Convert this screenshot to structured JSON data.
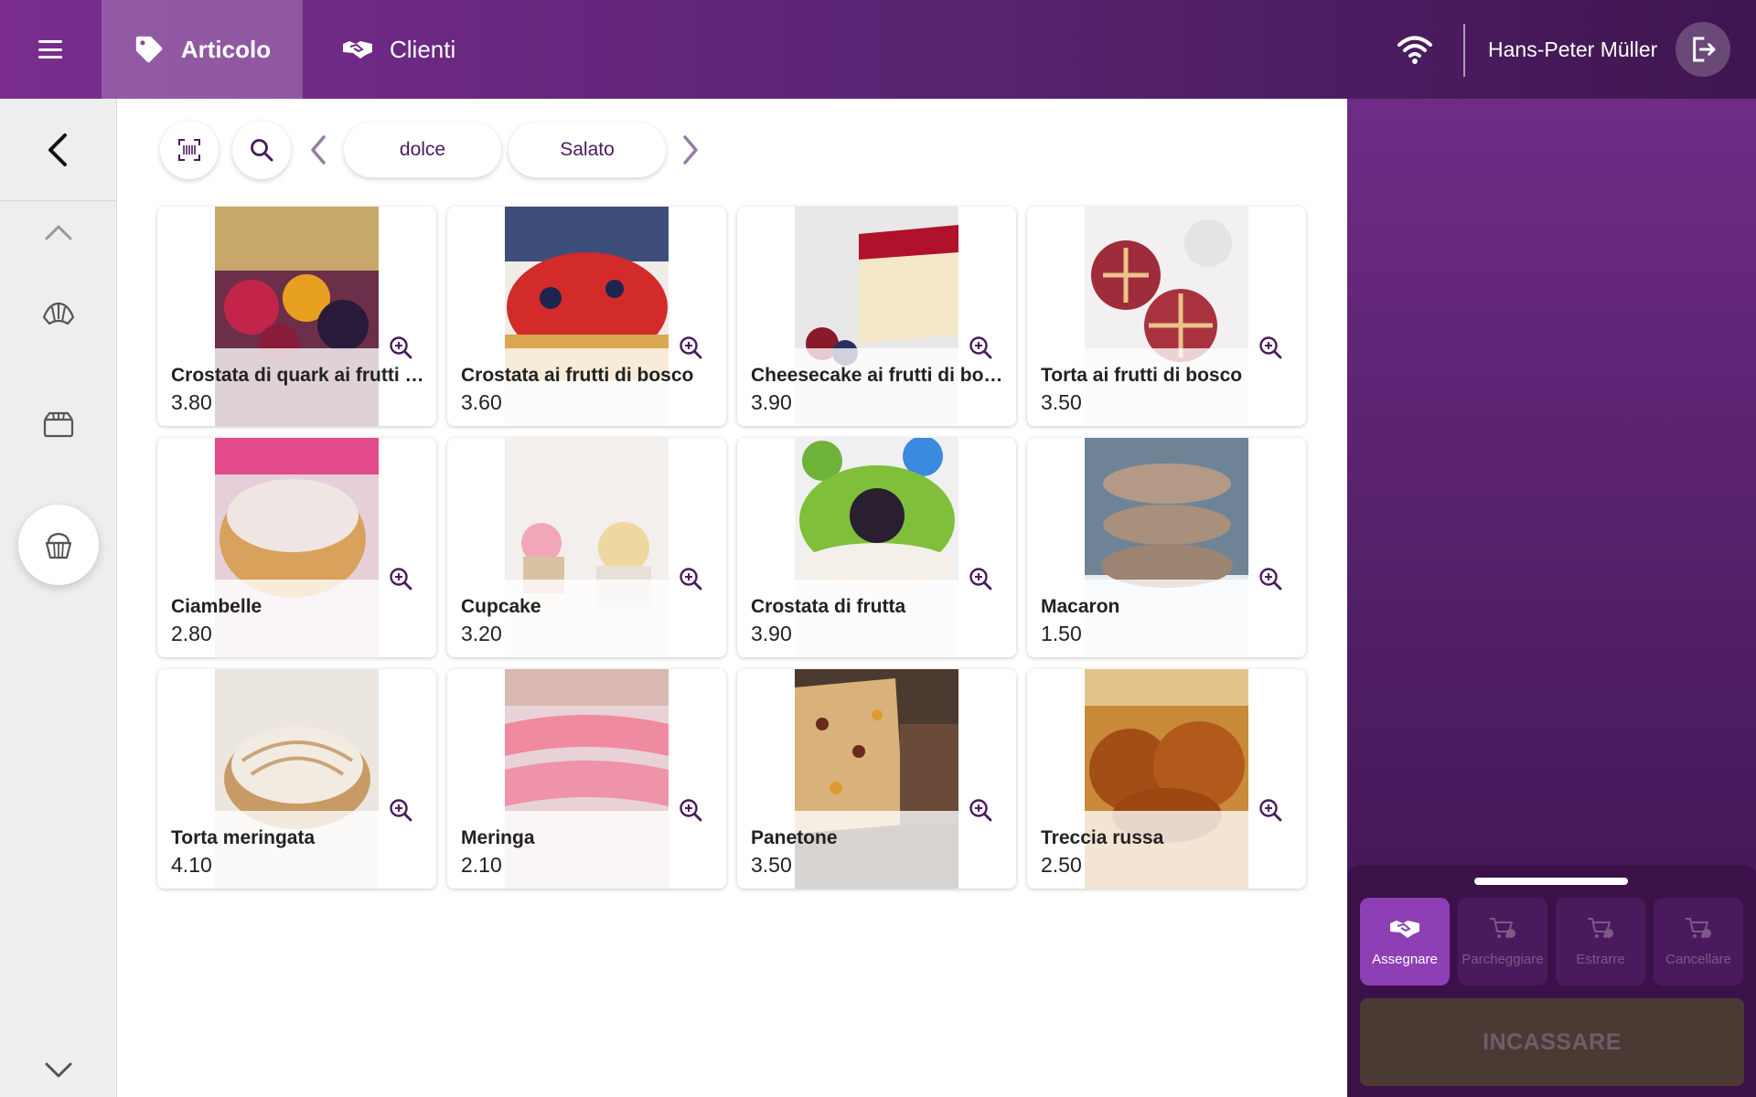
{
  "header": {
    "menu_icon": "hamburger-menu-icon",
    "tabs": [
      {
        "label": "Articolo",
        "icon": "tag-icon",
        "active": true
      },
      {
        "label": "Clienti",
        "icon": "handshake-icon",
        "active": false
      }
    ],
    "wifi_icon": "wifi-icon",
    "user_name": "Hans-Peter Müller",
    "logout_icon": "logout-icon"
  },
  "sidebar": {
    "back_icon": "chevron-left-icon",
    "scroll_up_icon": "chevron-up-icon",
    "scroll_down_icon": "chevron-down-icon",
    "categories": [
      {
        "icon": "croissant-icon",
        "active": false
      },
      {
        "icon": "cake-box-icon",
        "active": false
      },
      {
        "icon": "cupcake-icon",
        "active": true
      }
    ]
  },
  "filters": {
    "barcode_icon": "barcode-scan-icon",
    "search_icon": "search-icon",
    "prev_icon": "chevron-left-icon",
    "next_icon": "chevron-right-icon",
    "pills": [
      "dolce",
      "Salato"
    ]
  },
  "products": [
    {
      "name": "Crostata di quark ai frutti di bosco",
      "price": "3.80"
    },
    {
      "name": "Crostata ai frutti di bosco",
      "price": "3.60"
    },
    {
      "name": "Cheesecake ai frutti di bosco",
      "price": "3.90"
    },
    {
      "name": "Torta ai frutti di bosco",
      "price": "3.50"
    },
    {
      "name": "Ciambelle",
      "price": "2.80"
    },
    {
      "name": "Cupcake",
      "price": "3.20"
    },
    {
      "name": "Crostata di frutta",
      "price": "3.90"
    },
    {
      "name": "Macaron",
      "price": "1.50"
    },
    {
      "name": "Torta meringata",
      "price": "4.10"
    },
    {
      "name": "Meringa",
      "price": "2.10"
    },
    {
      "name": "Panetone",
      "price": "3.50"
    },
    {
      "name": "Treccia russa",
      "price": "2.50"
    }
  ],
  "cart_actions": [
    {
      "label": "Assegnare",
      "icon": "handshake-icon",
      "active": true
    },
    {
      "label": "Parcheggiare",
      "icon": "cart-park-icon",
      "active": false
    },
    {
      "label": "Estrarre",
      "icon": "cart-extract-icon",
      "active": false
    },
    {
      "label": "Cancellare",
      "icon": "cart-remove-icon",
      "active": false
    }
  ],
  "checkout_label": "INCASSARE",
  "colors": {
    "accent": "#8e3fb5",
    "header_start": "#7a2d8f",
    "header_end": "#3f1650",
    "panel": "#5e2577",
    "checkout_disabled": "#4b3a33"
  }
}
